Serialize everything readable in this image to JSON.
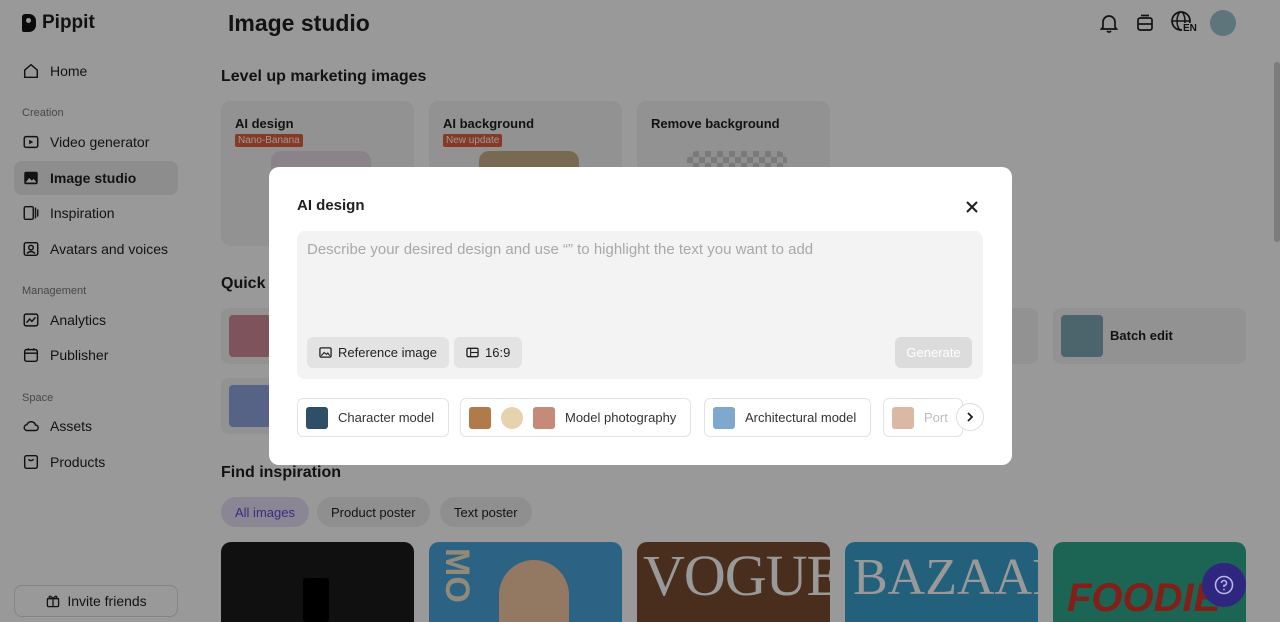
{
  "brand": {
    "name": "Pippit"
  },
  "sidebar": {
    "items": [
      {
        "label": "Home",
        "icon": "home-icon"
      },
      {
        "label": "Video generator",
        "icon": "video-icon"
      },
      {
        "label": "Image studio",
        "icon": "image-icon",
        "active": true
      },
      {
        "label": "Inspiration",
        "icon": "inspiration-icon"
      },
      {
        "label": "Avatars and voices",
        "icon": "avatar-icon"
      },
      {
        "label": "Analytics",
        "icon": "analytics-icon"
      },
      {
        "label": "Publisher",
        "icon": "calendar-icon"
      },
      {
        "label": "Assets",
        "icon": "cloud-icon"
      },
      {
        "label": "Products",
        "icon": "product-icon"
      }
    ],
    "sections": {
      "creation": "Creation",
      "management": "Management",
      "space": "Space"
    },
    "invite_label": "Invite friends"
  },
  "header": {
    "title": "Image studio",
    "language": "EN"
  },
  "main": {
    "marketing_heading": "Level up marketing images",
    "cards": [
      {
        "title": "AI design",
        "badge": "Nano-Banana"
      },
      {
        "title": "AI background",
        "badge": "New update"
      },
      {
        "title": "Remove background",
        "badge": ""
      }
    ],
    "quick_tools_heading": "Quick t",
    "batch_edit_label": "Batch edit",
    "inspiration_heading": "Find inspiration",
    "filters": [
      "All images",
      "Product poster",
      "Text poster"
    ],
    "gallery_text": [
      "VOGUE",
      "BAZAAR",
      "FOODIE",
      "MO"
    ]
  },
  "modal": {
    "title": "AI design",
    "prompt_placeholder": "Describe your desired design and use “” to highlight the text you want to add",
    "prompt_value": "",
    "reference_label": "Reference image",
    "ratio_label": "16:9",
    "generate_label": "Generate",
    "presets": [
      "Character model",
      "Model photography",
      "Architectural model",
      "Port"
    ]
  },
  "colors": {
    "accent": "#4e3fd4",
    "badge": "#e0603e",
    "active_filter_bg": "#e6e0f7"
  }
}
